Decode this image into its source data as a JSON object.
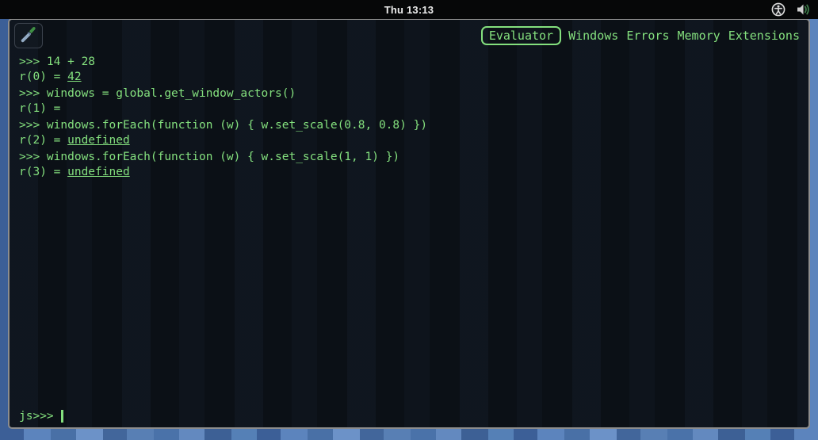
{
  "colors": {
    "accent_green": "#84e07e",
    "window_border": "#8d8d8d",
    "top_bar_bg": "#060708",
    "console_bg": "#0b1016"
  },
  "top_bar": {
    "clock": "Thu 13:13"
  },
  "looking_glass": {
    "tabs": {
      "selected": "Evaluator",
      "evaluator": "Evaluator",
      "windows": "Windows",
      "errors": "Errors",
      "memory": "Memory",
      "extensions": "Extensions"
    },
    "console": {
      "entries": [
        {
          "input": ">>> 14 + 28",
          "result_label": "r(0) = ",
          "result_value": "42"
        },
        {
          "input": ">>> windows = global.get_window_actors()",
          "result_label": "r(1) = ",
          "result_value": ""
        },
        {
          "input": ">>> windows.forEach(function (w) { w.set_scale(0.8, 0.8) })",
          "result_label": "r(2) = ",
          "result_value": "undefined"
        },
        {
          "input": ">>> windows.forEach(function (w) { w.set_scale(1, 1) })",
          "result_label": "r(3) = ",
          "result_value": "undefined"
        }
      ]
    },
    "prompt": {
      "label": "js>>>"
    }
  }
}
